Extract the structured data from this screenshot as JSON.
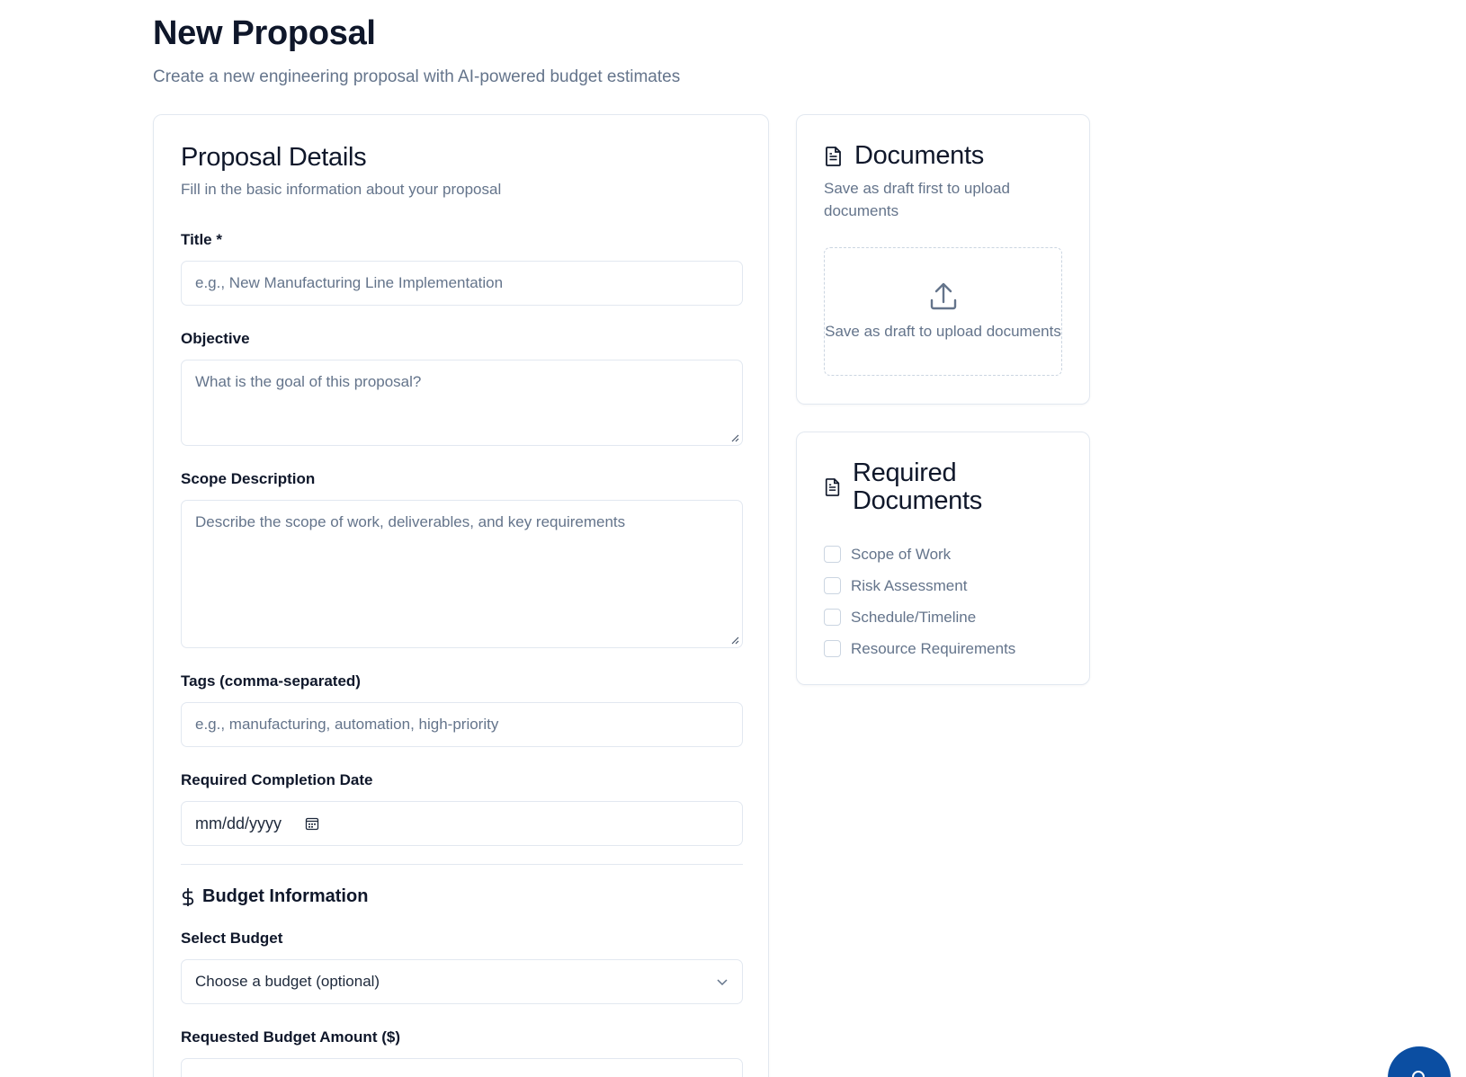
{
  "header": {
    "title": "New Proposal",
    "subtitle": "Create a new engineering proposal with AI-powered budget estimates"
  },
  "details": {
    "title": "Proposal Details",
    "description": "Fill in the basic information about your proposal",
    "fields": {
      "title": {
        "label": "Title *",
        "placeholder": "e.g., New Manufacturing Line Implementation"
      },
      "objective": {
        "label": "Objective",
        "placeholder": "What is the goal of this proposal?"
      },
      "scope": {
        "label": "Scope Description",
        "placeholder": "Describe the scope of work, deliverables, and key requirements"
      },
      "tags": {
        "label": "Tags (comma-separated)",
        "placeholder": "e.g., manufacturing, automation, high-priority"
      },
      "date": {
        "label": "Required Completion Date",
        "value": "mm/dd/yyyy"
      }
    },
    "budget": {
      "section_title": "Budget Information",
      "select_label": "Select Budget",
      "select_value": "Choose a budget (optional)",
      "amount_label": "Requested Budget Amount ($)"
    }
  },
  "documents": {
    "title": "Documents",
    "description": "Save as draft first to upload documents",
    "upload_text": "Save as draft to upload documents"
  },
  "required_documents": {
    "title": "Required Documents",
    "items": [
      "Scope of Work",
      "Risk Assessment",
      "Schedule/Timeline",
      "Resource Requirements"
    ]
  },
  "colors": {
    "accent": "#0b4ea2",
    "text": "#0f172a",
    "muted": "#64748b",
    "border": "#e2e8f0"
  }
}
